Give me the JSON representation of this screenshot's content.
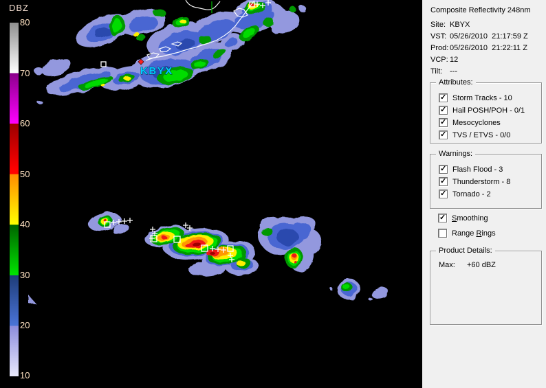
{
  "scale": {
    "title": "DBZ",
    "ticks": [
      "80",
      "70",
      "60",
      "50",
      "40",
      "30",
      "20",
      "10"
    ],
    "unit": "dBZ"
  },
  "radar": {
    "site_label": "KBYX"
  },
  "panel": {
    "title": "Composite Reflectivity 248nm",
    "info": [
      {
        "label": "Site:",
        "value": "KBYX"
      },
      {
        "label": "VST:",
        "value": "05/26/2010  21:17:59 Z"
      },
      {
        "label": "Prod:",
        "value": "05/26/2010  21:22:11 Z"
      },
      {
        "label": "VCP:",
        "value": "12"
      },
      {
        "label": "Tilt:",
        "value": "---"
      }
    ],
    "attributes": {
      "legend": "Attributes:",
      "items": [
        {
          "label": "Storm Tracks - 10",
          "checked": true
        },
        {
          "label": "Hail POSH/POH - 0/1",
          "checked": true
        },
        {
          "label": "Mesocyclones",
          "checked": true
        },
        {
          "label": "TVS / ETVS - 0/0",
          "checked": true
        }
      ]
    },
    "warnings": {
      "legend": "Warnings:",
      "items": [
        {
          "label": "Flash Flood - 3",
          "checked": true
        },
        {
          "label": "Thunderstorm - 8",
          "checked": true
        },
        {
          "label": "Tornado - 2",
          "checked": true
        }
      ]
    },
    "options": {
      "smoothing": {
        "pre": "",
        "key": "S",
        "post": "moothing",
        "checked": true
      },
      "range_rings": {
        "pre": "Range ",
        "key": "R",
        "post": "ings",
        "checked": false
      }
    },
    "product_details": {
      "legend": "Product Details:",
      "max_label": "Max:",
      "max_value": "+60 dBZ"
    }
  },
  "colors": {
    "panel_bg": "#f0f0f0",
    "radar_bg": "#000000",
    "site_label": "#00ccff",
    "site_marker": "#ff2020",
    "scale_tick_text": "#ffe2c2",
    "coastline": "#ffffff"
  }
}
